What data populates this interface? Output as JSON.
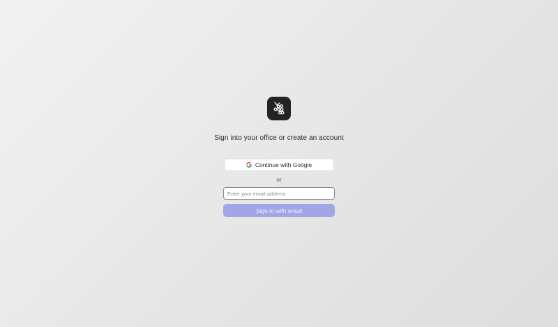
{
  "logo": {
    "icon": "grape-cluster-icon",
    "background": "#232323"
  },
  "heading": "Sign into your office or create an account",
  "google_button": {
    "label": "Continue with Google",
    "icon": "google-g-icon"
  },
  "divider_text": "or",
  "email_input": {
    "value": "",
    "placeholder": "Enter your email address"
  },
  "signin_button": {
    "label": "Sign in with email",
    "color": "#a3a6e6"
  }
}
